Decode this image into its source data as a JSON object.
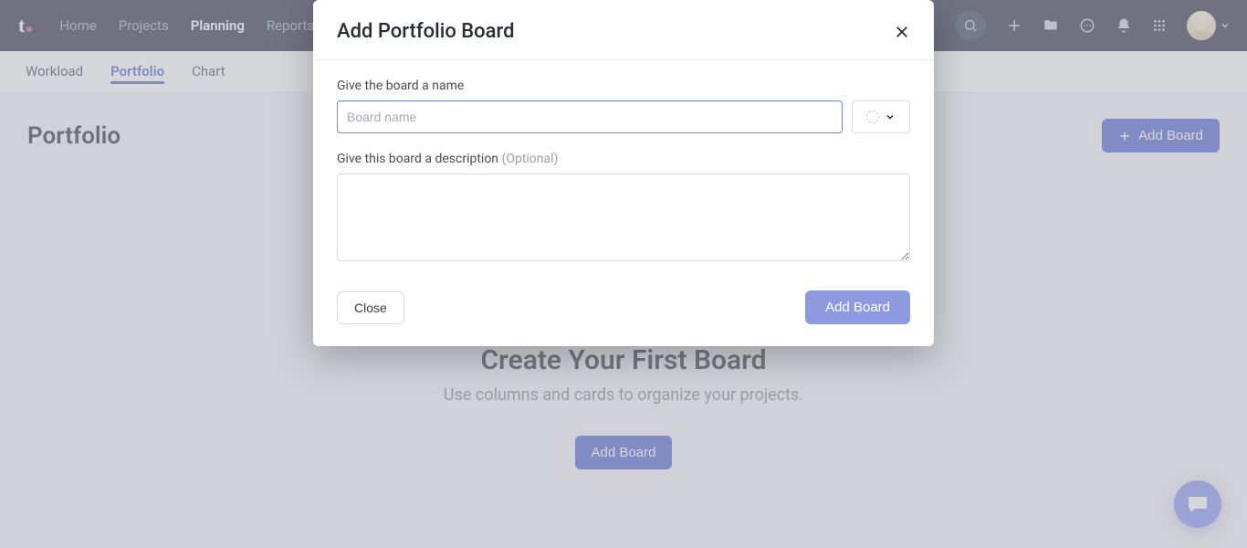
{
  "nav": {
    "items": [
      {
        "label": "Home",
        "active": false
      },
      {
        "label": "Projects",
        "active": false
      },
      {
        "label": "Planning",
        "active": true
      },
      {
        "label": "Reports",
        "active": false
      }
    ]
  },
  "subtabs": [
    {
      "label": "Workload",
      "active": false
    },
    {
      "label": "Portfolio",
      "active": true
    },
    {
      "label": "Chart",
      "active": false
    }
  ],
  "page": {
    "title": "Portfolio",
    "add_board_label": "Add Board"
  },
  "empty": {
    "title": "Create Your First Board",
    "subtitle": "Use columns and cards to organize your projects.",
    "cta": "Add Board"
  },
  "modal": {
    "title": "Add Portfolio Board",
    "name_label": "Give the board a name",
    "name_placeholder": "Board name",
    "desc_label": "Give this board a description",
    "desc_optional": "(Optional)",
    "close_label": "Close",
    "submit_label": "Add Board"
  }
}
